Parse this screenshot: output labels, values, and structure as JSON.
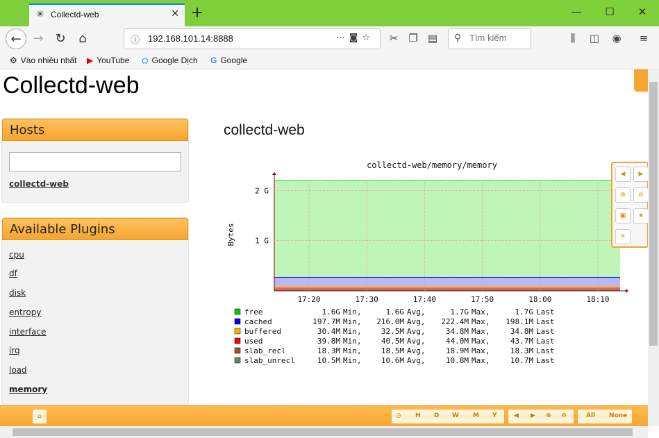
{
  "browser": {
    "tab_title": "Collectd-web",
    "tab_icon": "gear-icon",
    "url": "192.168.101.14:8888",
    "search_placeholder": "Tìm kiếm"
  },
  "bookmarks": [
    {
      "label": "Vào nhiều nhất",
      "icon": "gear-icon"
    },
    {
      "label": "YouTube",
      "icon": "youtube-icon"
    },
    {
      "label": "Google Dịch",
      "icon": "translate-icon"
    },
    {
      "label": "Google",
      "icon": "google-icon"
    }
  ],
  "page": {
    "title": "Collectd-web",
    "host_heading": "collectd-web"
  },
  "hosts": {
    "heading": "Hosts",
    "search_value": "",
    "items": [
      "collectd-web"
    ]
  },
  "plugins": {
    "heading": "Available Plugins",
    "items": [
      "cpu",
      "df",
      "disk",
      "entropy",
      "interface",
      "irq",
      "load",
      "memory"
    ],
    "active": "memory"
  },
  "chart_data": {
    "type": "area",
    "title": "collectd-web/memory/memory",
    "ylabel": "Bytes",
    "xlabel": "",
    "x_ticks": [
      "17:20",
      "17:30",
      "17:40",
      "17:50",
      "18:00",
      "18:10"
    ],
    "y_ticks": [
      "2 G",
      "1 G"
    ],
    "ylim": [
      0,
      2.2
    ],
    "series": [
      {
        "name": "free",
        "color": "#00cc00",
        "min": "1.6G",
        "avg": "1.6G",
        "max": "1.7G",
        "last": "1.7G"
      },
      {
        "name": "cached",
        "color": "#0000ff",
        "min": "197.7M",
        "avg": "216.0M",
        "max": "222.4M",
        "last": "198.1M"
      },
      {
        "name": "buffered",
        "color": "#ffb000",
        "min": "30.4M",
        "avg": "32.5M",
        "max": "34.8M",
        "last": "34.8M"
      },
      {
        "name": "used",
        "color": "#ff0000",
        "min": "39.8M",
        "avg": "40.5M",
        "max": "44.0M",
        "last": "43.7M"
      },
      {
        "name": "slab_recl",
        "color": "#a0522d",
        "min": "18.3M",
        "avg": "18.5M",
        "max": "18.9M",
        "last": "18.3M"
      },
      {
        "name": "slab_unrecl",
        "color": "#708070",
        "min": "10.5M",
        "avg": "10.6M",
        "max": "10.8M",
        "last": "10.7M"
      }
    ],
    "legend_labels": {
      "min": "Min,",
      "avg": "Avg,",
      "max": "Max,",
      "last": "Last"
    }
  },
  "bottombar": {
    "periods": [
      "H",
      "D",
      "W",
      "M",
      "Y"
    ],
    "all_label": "All",
    "none_label": "None"
  }
}
